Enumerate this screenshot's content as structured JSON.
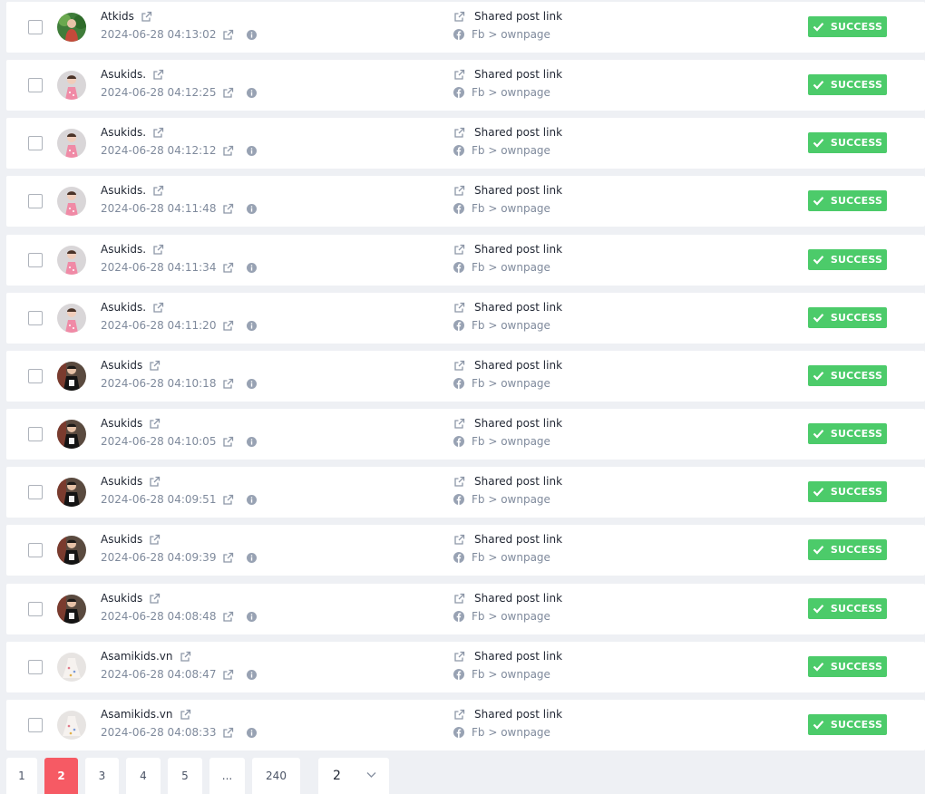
{
  "entries": [
    {
      "name": "Atkids",
      "timestamp": "2024-06-28 04:13:02",
      "action": "Shared post link",
      "source": "Fb > ownpage",
      "status": "SUCCESS",
      "avatar": "green-kid"
    },
    {
      "name": "Asukids.",
      "timestamp": "2024-06-28 04:12:25",
      "action": "Shared post link",
      "source": "Fb > ownpage",
      "status": "SUCCESS",
      "avatar": "pink-girl"
    },
    {
      "name": "Asukids.",
      "timestamp": "2024-06-28 04:12:12",
      "action": "Shared post link",
      "source": "Fb > ownpage",
      "status": "SUCCESS",
      "avatar": "pink-girl"
    },
    {
      "name": "Asukids.",
      "timestamp": "2024-06-28 04:11:48",
      "action": "Shared post link",
      "source": "Fb > ownpage",
      "status": "SUCCESS",
      "avatar": "pink-girl"
    },
    {
      "name": "Asukids.",
      "timestamp": "2024-06-28 04:11:34",
      "action": "Shared post link",
      "source": "Fb > ownpage",
      "status": "SUCCESS",
      "avatar": "pink-girl"
    },
    {
      "name": "Asukids.",
      "timestamp": "2024-06-28 04:11:20",
      "action": "Shared post link",
      "source": "Fb > ownpage",
      "status": "SUCCESS",
      "avatar": "pink-girl"
    },
    {
      "name": "Asukids",
      "timestamp": "2024-06-28 04:10:18",
      "action": "Shared post link",
      "source": "Fb > ownpage",
      "status": "SUCCESS",
      "avatar": "dark-kid"
    },
    {
      "name": "Asukids",
      "timestamp": "2024-06-28 04:10:05",
      "action": "Shared post link",
      "source": "Fb > ownpage",
      "status": "SUCCESS",
      "avatar": "dark-kid"
    },
    {
      "name": "Asukids",
      "timestamp": "2024-06-28 04:09:51",
      "action": "Shared post link",
      "source": "Fb > ownpage",
      "status": "SUCCESS",
      "avatar": "dark-kid"
    },
    {
      "name": "Asukids",
      "timestamp": "2024-06-28 04:09:39",
      "action": "Shared post link",
      "source": "Fb > ownpage",
      "status": "SUCCESS",
      "avatar": "dark-kid"
    },
    {
      "name": "Asukids",
      "timestamp": "2024-06-28 04:08:48",
      "action": "Shared post link",
      "source": "Fb > ownpage",
      "status": "SUCCESS",
      "avatar": "dark-kid"
    },
    {
      "name": "Asamikids.vn",
      "timestamp": "2024-06-28 04:08:47",
      "action": "Shared post link",
      "source": "Fb > ownpage",
      "status": "SUCCESS",
      "avatar": "light-dress"
    },
    {
      "name": "Asamikids.vn",
      "timestamp": "2024-06-28 04:08:33",
      "action": "Shared post link",
      "source": "Fb > ownpage",
      "status": "SUCCESS",
      "avatar": "light-dress"
    }
  ],
  "pagination": {
    "pages": [
      "1",
      "2",
      "3",
      "4",
      "5",
      "...",
      "240"
    ],
    "current_page": "2",
    "page_select_value": "2"
  },
  "colors": {
    "success": "#4ccb6a",
    "active_page": "#f65a64",
    "muted_text": "#7f8a9c",
    "background": "#eef0f4"
  }
}
